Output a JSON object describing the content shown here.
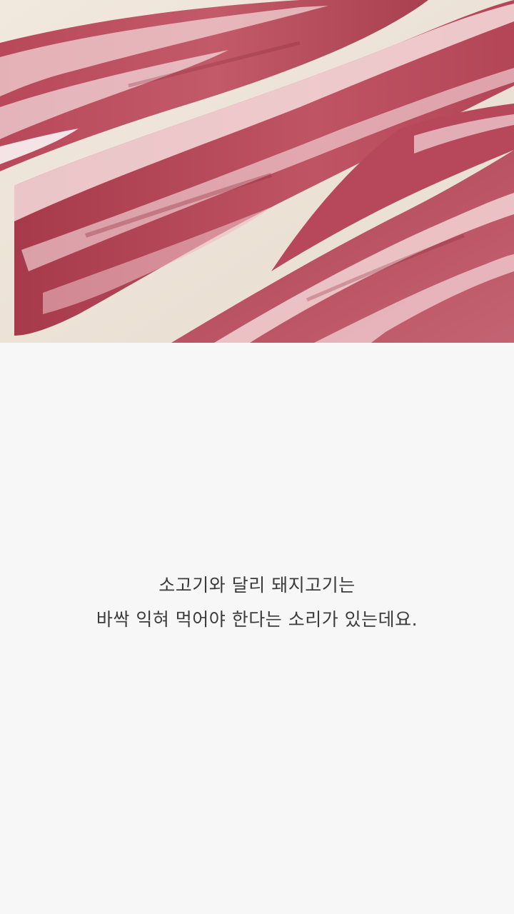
{
  "hero": {
    "image_icon": "pork-belly-photo"
  },
  "caption": {
    "line1": "소고기와 달리 돼지고기는",
    "line2": "바싹 익혀 먹어야 한다는 소리가 있는데요."
  },
  "colors": {
    "background": "#f7f7f7",
    "text": "#3b3b3b"
  }
}
